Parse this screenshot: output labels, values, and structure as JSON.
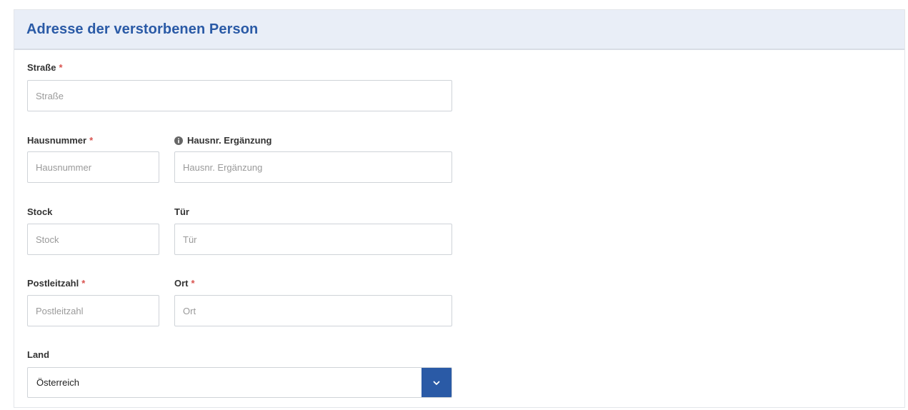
{
  "panel": {
    "title": "Adresse der verstorbenen Person"
  },
  "fields": {
    "strasse": {
      "label": "Straße",
      "required_mark": "*",
      "placeholder": "Straße",
      "value": ""
    },
    "hausnummer": {
      "label": "Hausnummer",
      "required_mark": "*",
      "placeholder": "Hausnummer",
      "value": ""
    },
    "hausnr_ergaenzung": {
      "label": "Hausnr. Ergänzung",
      "placeholder": "Hausnr. Ergänzung",
      "value": "",
      "icon": "info-icon"
    },
    "stock": {
      "label": "Stock",
      "placeholder": "Stock",
      "value": ""
    },
    "tuer": {
      "label": "Tür",
      "placeholder": "Tür",
      "value": ""
    },
    "postleitzahl": {
      "label": "Postleitzahl",
      "required_mark": "*",
      "placeholder": "Postleitzahl",
      "value": ""
    },
    "ort": {
      "label": "Ort",
      "required_mark": "*",
      "placeholder": "Ort",
      "value": ""
    },
    "land": {
      "label": "Land",
      "selected": "Österreich",
      "icon": "chevron-down-icon"
    }
  },
  "colors": {
    "accent": "#2a5aa6",
    "required": "#d9534f",
    "header_bg": "#e9eef7"
  }
}
